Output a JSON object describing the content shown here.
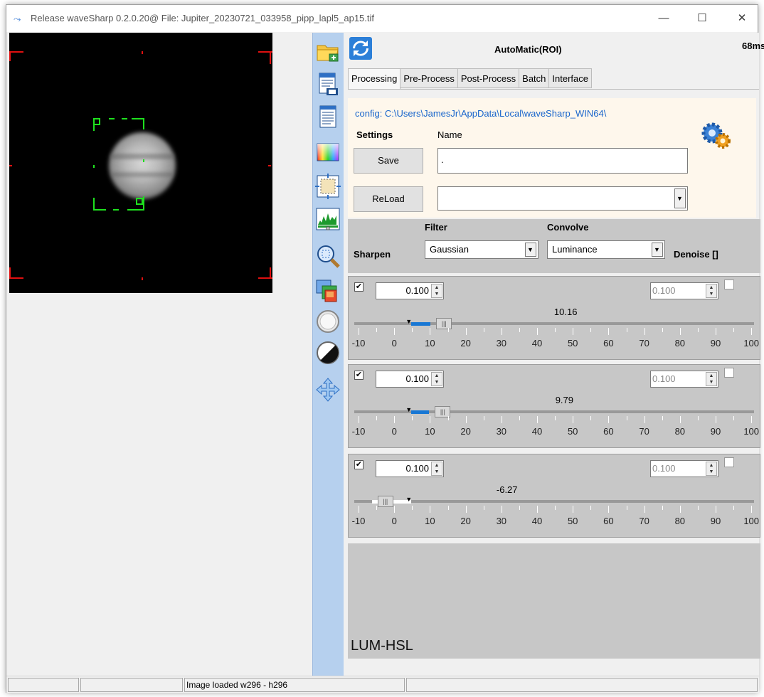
{
  "window": {
    "title": "Release waveSharp 0.2.0.20@   File: Jupiter_20230721_033958_pipp_lapl5_ap15.tif",
    "controls": [
      "—",
      "☐",
      "✕"
    ]
  },
  "header": {
    "mode_title": "AutoMatic(ROI)",
    "timing": "68ms"
  },
  "tabs": [
    {
      "label": "Processing"
    },
    {
      "label": "Pre-Process"
    },
    {
      "label": "Post-Process"
    },
    {
      "label": "Batch"
    },
    {
      "label": "Interface"
    }
  ],
  "settings": {
    "config_path": "config: C:\\Users\\JamesJr\\AppData\\Local\\waveSharp_WIN64\\",
    "settings_label": "Settings",
    "name_label": "Name",
    "save_label": "Save",
    "reload_label": "ReLoad",
    "name_value": ".",
    "reload_value": ""
  },
  "filter": {
    "filter_header": "Filter",
    "convolve_header": "Convolve",
    "sharpen_label": "Sharpen",
    "filter_value": "Gaussian",
    "convolve_value": "Luminance",
    "denoise_label": "Denoise []"
  },
  "layers": [
    {
      "checked": true,
      "spin_value": "0.100",
      "denoise_value": "0.100",
      "slider_value": "10.16",
      "value": 10.16
    },
    {
      "checked": true,
      "spin_value": "0.100",
      "denoise_value": "0.100",
      "slider_value": "9.79",
      "value": 9.79
    },
    {
      "checked": true,
      "spin_value": "0.100",
      "denoise_value": "0.100",
      "slider_value": "-6.27",
      "value": -6.27
    }
  ],
  "scale_labels": [
    "-10",
    "0",
    "10",
    "20",
    "30",
    "40",
    "50",
    "60",
    "70",
    "80",
    "90",
    "100"
  ],
  "lower": {
    "mode_label": "LUM-HSL"
  },
  "status": {
    "message": "Image loaded w296 - h296"
  },
  "colors": {
    "accent": "#1a66cc",
    "slider_fill": "#1877d4",
    "roi_box": "#1ee01e",
    "frame_marks": "#e01010"
  },
  "icons": {
    "toolbar": [
      "open-folder-icon",
      "save-file-icon",
      "document-icon",
      "color-spectrum-icon",
      "crop-roi-icon",
      "histogram-icon",
      "zoom-icon",
      "layers-icon",
      "circle-icon",
      "contrast-icon",
      "move-arrows-icon"
    ]
  }
}
